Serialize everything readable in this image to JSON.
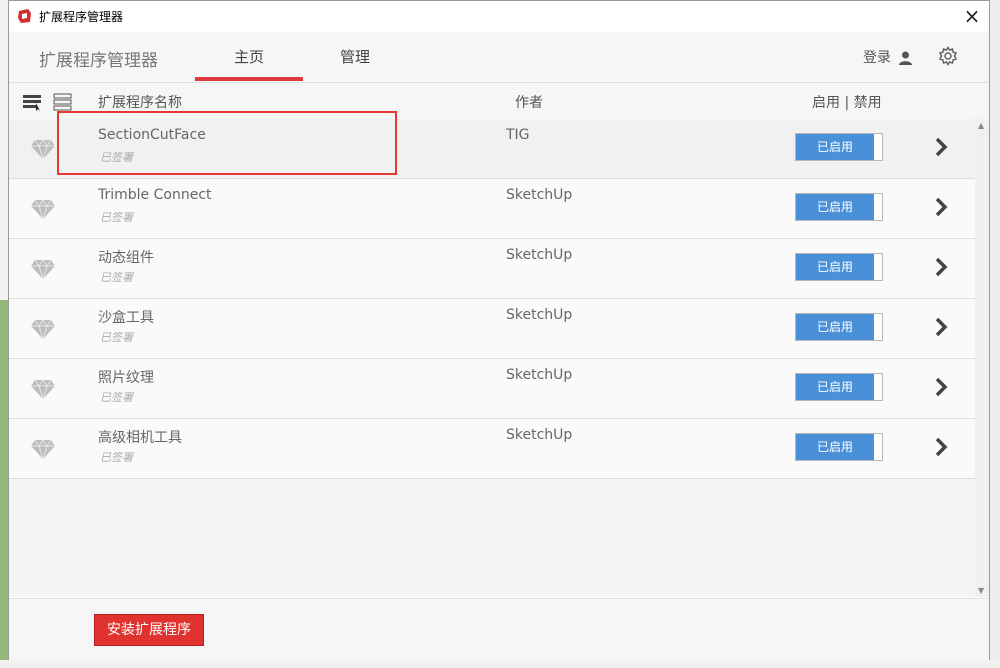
{
  "window": {
    "title": "扩展程序管理器",
    "close_label": "×"
  },
  "header": {
    "app_title": "扩展程序管理器",
    "tabs": [
      {
        "label": "主页"
      },
      {
        "label": "管理"
      }
    ],
    "login_label": "登录"
  },
  "columns": {
    "name": "扩展程序名称",
    "author": "作者",
    "status": "启用 | 禁用"
  },
  "extensions": [
    {
      "name": "SectionCutFace",
      "signed": "已签署",
      "author": "TIG",
      "status": "已启用"
    },
    {
      "name": "Trimble Connect",
      "signed": "已签署",
      "author": "SketchUp",
      "status": "已启用"
    },
    {
      "name": "动态组件",
      "signed": "已签署",
      "author": "SketchUp",
      "status": "已启用"
    },
    {
      "name": "沙盒工具",
      "signed": "已签署",
      "author": "SketchUp",
      "status": "已启用"
    },
    {
      "name": "照片纹理",
      "signed": "已签署",
      "author": "SketchUp",
      "status": "已启用"
    },
    {
      "name": "高级相机工具",
      "signed": "已签署",
      "author": "SketchUp",
      "status": "已启用"
    }
  ],
  "footer": {
    "install_label": "安装扩展程序"
  },
  "colors": {
    "accent": "#e0322e",
    "toggle_on": "#4a90d9"
  }
}
